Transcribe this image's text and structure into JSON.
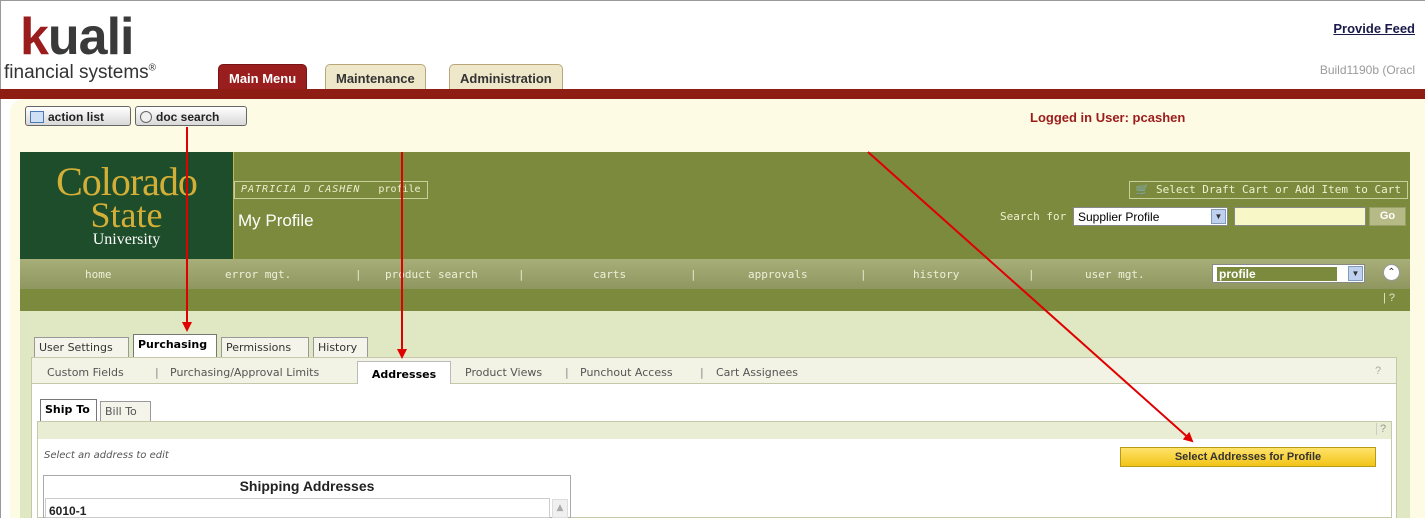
{
  "header": {
    "logo_text_k": "k",
    "logo_text_rest": "uali",
    "logo_subtitle": "financial systems",
    "logo_registered": "®",
    "provide_feedback": "Provide Feed",
    "build_info": "Build1190b (Oracl",
    "main_tabs": [
      {
        "label": "Main Menu",
        "active": true
      },
      {
        "label": "Maintenance",
        "active": false
      },
      {
        "label": "Administration",
        "active": false
      }
    ]
  },
  "toolbar": {
    "action_list": "action list",
    "doc_search": "doc search",
    "logged_in": "Logged in User: pcashen"
  },
  "csu": {
    "logo_line1": "Colorado",
    "logo_line2": "State",
    "logo_line3": "University",
    "user_name": "PATRICIA D CASHEN",
    "profile_link": "profile",
    "page_title": "My Profile",
    "cart_link": "Select Draft Cart or Add Item to Cart",
    "search_label": "Search for",
    "search_select_value": "Supplier Profile",
    "go_label": "Go"
  },
  "nav": {
    "items": [
      "home",
      "error mgt.",
      "product search",
      "carts",
      "approvals",
      "history",
      "user mgt."
    ],
    "separator": "|",
    "profile_select_value": "profile",
    "help": "?"
  },
  "profile_tabs": [
    {
      "label": "User Settings",
      "active": false
    },
    {
      "label": "Purchasing",
      "active": true
    },
    {
      "label": "Permissions",
      "active": false
    },
    {
      "label": "History",
      "active": false
    }
  ],
  "sub_tabs": {
    "items": [
      "Custom Fields",
      "Purchasing/Approval Limits",
      "Addresses",
      "Product Views",
      "Punchout Access",
      "Cart Assignees"
    ],
    "active": "Addresses",
    "help": "?"
  },
  "address_tabs": [
    {
      "label": "Ship To",
      "active": true
    },
    {
      "label": "Bill To",
      "active": false
    }
  ],
  "addresses": {
    "help": "?",
    "hint": "Select an address to edit",
    "select_button": "Select Addresses for Profile",
    "table_header": "Shipping Addresses",
    "rows": [
      "6010-1"
    ]
  },
  "colors": {
    "kuali_red": "#9b1c1c",
    "csu_green": "#1e4d2b",
    "olive": "#7b8a3c",
    "arrow_red": "#e00000",
    "button_yellow": "#f2c418"
  }
}
